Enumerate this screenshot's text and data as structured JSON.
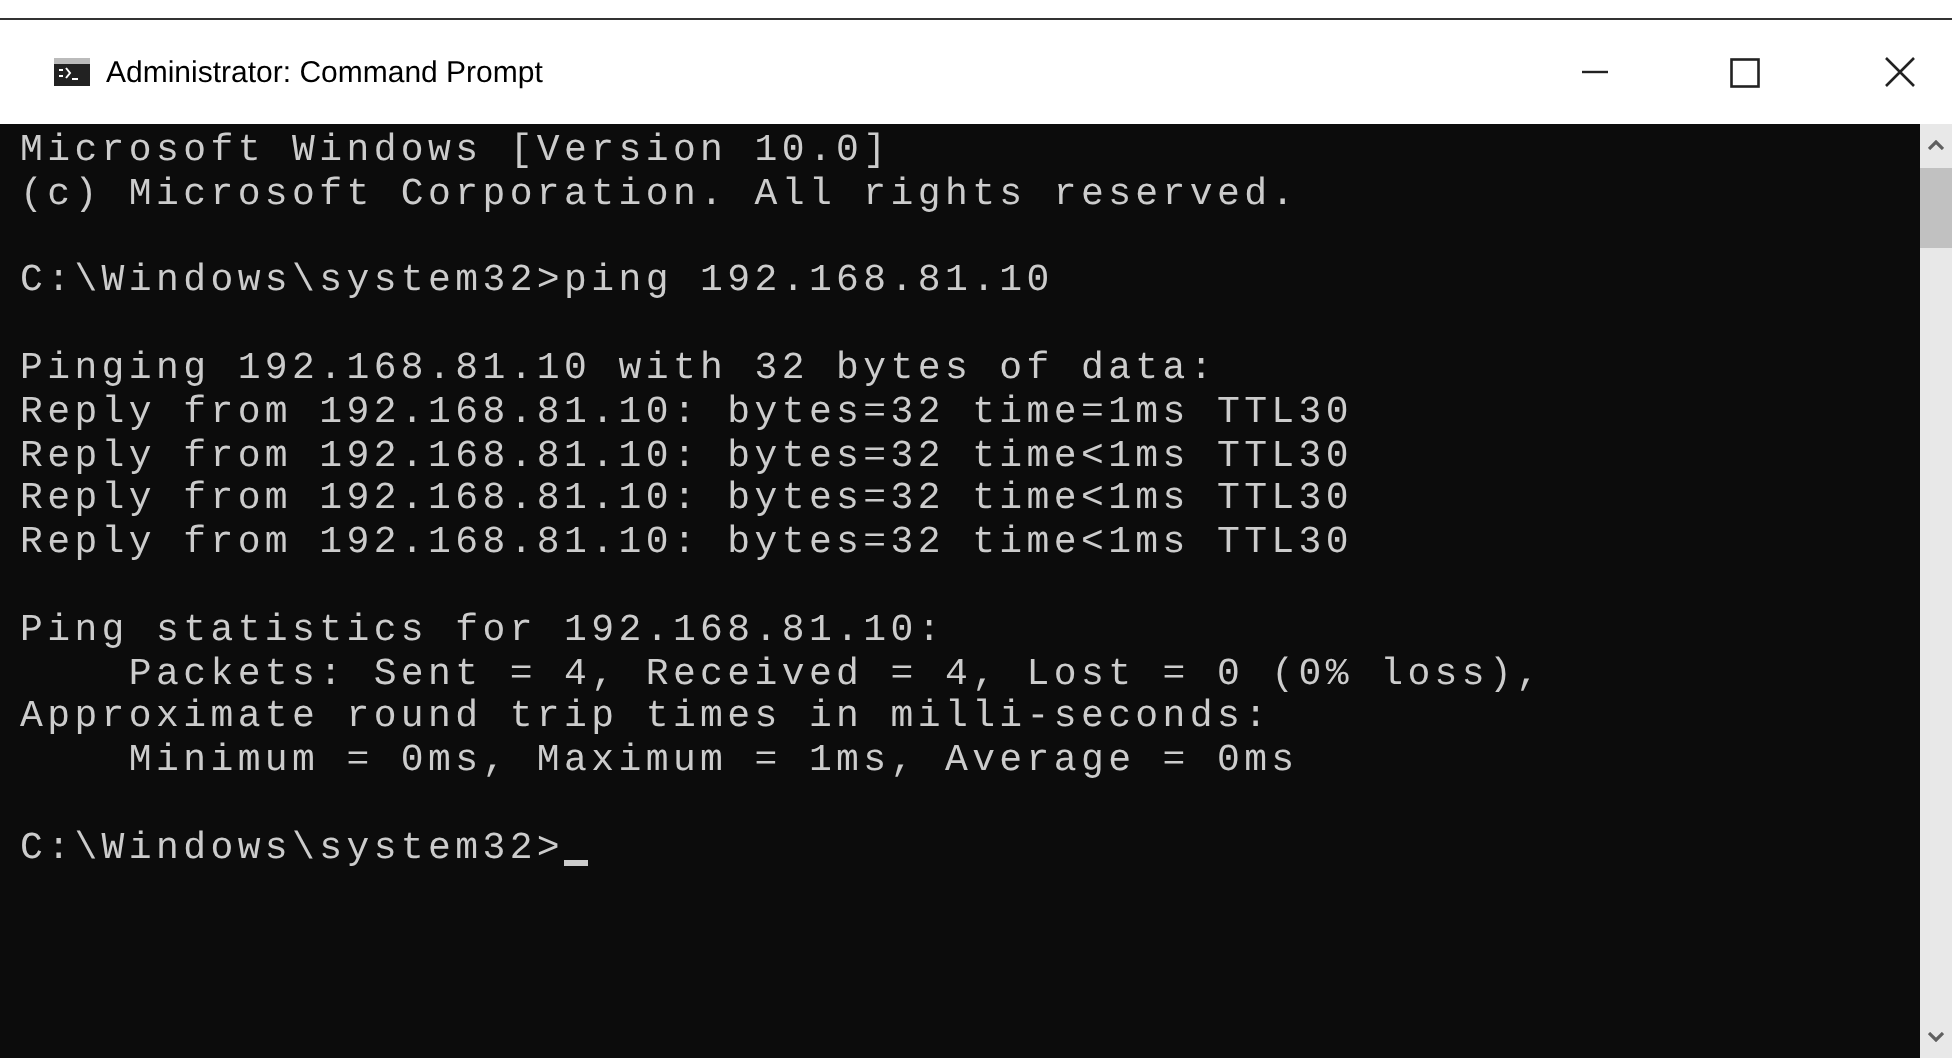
{
  "window": {
    "title": "Administrator: Command Prompt"
  },
  "console": {
    "blocks": [
      [
        "Microsoft Windows [Version 10.0]",
        "(c) Microsoft Corporation. All rights reserved."
      ],
      [
        "C:\\Windows\\system32>ping 192.168.81.10"
      ],
      [
        "Pinging 192.168.81.10 with 32 bytes of data:",
        "Reply from 192.168.81.10: bytes=32 time=1ms TTL30",
        "Reply from 192.168.81.10: bytes=32 time<1ms TTL30",
        "Reply from 192.168.81.10: bytes=32 time<1ms TTL30",
        "Reply from 192.168.81.10: bytes=32 time<1ms TTL30"
      ],
      [
        "Ping statistics for 192.168.81.10:",
        "    Packets: Sent = 4, Received = 4, Lost = 0 (0% loss),",
        "Approximate round trip times in milli-seconds:",
        "    Minimum = 0ms, Maximum = 1ms, Average = 0ms"
      ]
    ],
    "prompt": "C:\\Windows\\system32>"
  }
}
